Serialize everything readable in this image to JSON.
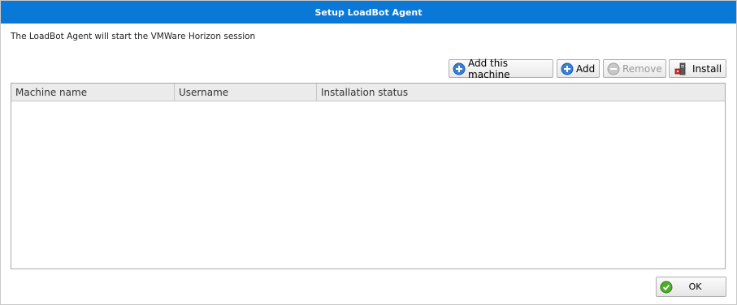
{
  "window": {
    "title": "Setup LoadBot Agent"
  },
  "description": "The LoadBot Agent will start the VMWare Horizon session",
  "toolbar": {
    "add_this_machine": {
      "label": "Add this machine",
      "icon": "add-circle-icon"
    },
    "add": {
      "label": "Add",
      "icon": "add-circle-icon"
    },
    "remove": {
      "label": "Remove",
      "icon": "remove-circle-icon",
      "disabled": true
    },
    "install": {
      "label": "Install",
      "icon": "install-machine-icon"
    }
  },
  "grid": {
    "columns": [
      "Machine name",
      "Username",
      "Installation status"
    ],
    "rows": []
  },
  "footer": {
    "ok_label": "OK",
    "ok_icon": "check-circle-icon"
  },
  "colors": {
    "title_bar": "#0a78d7",
    "add_icon": "#3a7fd0",
    "ok_icon": "#4caf28"
  }
}
